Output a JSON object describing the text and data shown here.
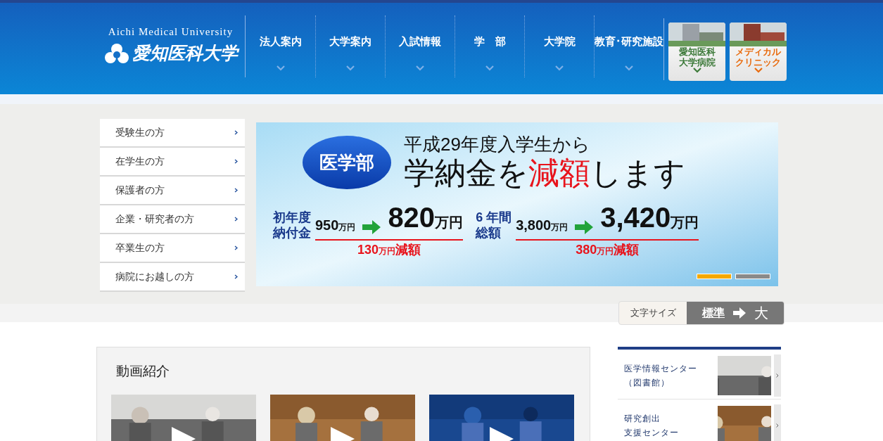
{
  "logo": {
    "english": "Aichi Medical University",
    "japanese": "愛知医科大学"
  },
  "nav": [
    {
      "label": "法人案内"
    },
    {
      "label": "大学案内"
    },
    {
      "label": "入試情報"
    },
    {
      "label": "学　部"
    },
    {
      "label": "大学院"
    },
    {
      "label": "教育･研究施設"
    }
  ],
  "hospital_buttons": [
    {
      "lines": [
        "愛知医科",
        "大学病院"
      ],
      "color": "#3d7a3a"
    },
    {
      "lines": [
        "メディカル",
        "クリニック"
      ],
      "color": "#e86a0c"
    }
  ],
  "sidebar": [
    {
      "label": "受験生の方"
    },
    {
      "label": "在学生の方"
    },
    {
      "label": "保護者の方"
    },
    {
      "label": "企業・研究者の方"
    },
    {
      "label": "卒業生の方"
    },
    {
      "label": "病院にお越しの方"
    }
  ],
  "banner": {
    "badge": "医学部",
    "subtitle": "平成29年度入学生から",
    "headline_before": "学納金を",
    "headline_emphasis": "減額",
    "headline_after": "します",
    "blocks": [
      {
        "label": [
          "初年度",
          "納付金"
        ],
        "old": "950",
        "old_unit": "万円",
        "new": "820",
        "new_unit": "万円",
        "reduction": "130",
        "reduction_unit": "万円",
        "reduction_suffix": "減額"
      },
      {
        "label": [
          "6 年間",
          "総額"
        ],
        "old": "3,800",
        "old_unit": "万円",
        "new": "3,420",
        "new_unit": "万円",
        "reduction": "380",
        "reduction_unit": "万円",
        "reduction_suffix": "減額"
      }
    ],
    "dots": [
      {
        "selected": true
      },
      {
        "selected": false
      }
    ]
  },
  "text_size": {
    "label": "文字サイズ",
    "options": [
      {
        "label": "標準",
        "selected": true
      },
      {
        "label": "大",
        "selected": false
      }
    ]
  },
  "videos": {
    "title": "動画紹介"
  },
  "facilities": [
    {
      "lines": [
        "医学情報センター",
        "（図書館）"
      ]
    },
    {
      "lines": [
        "研究創出",
        "支援センター"
      ]
    }
  ]
}
